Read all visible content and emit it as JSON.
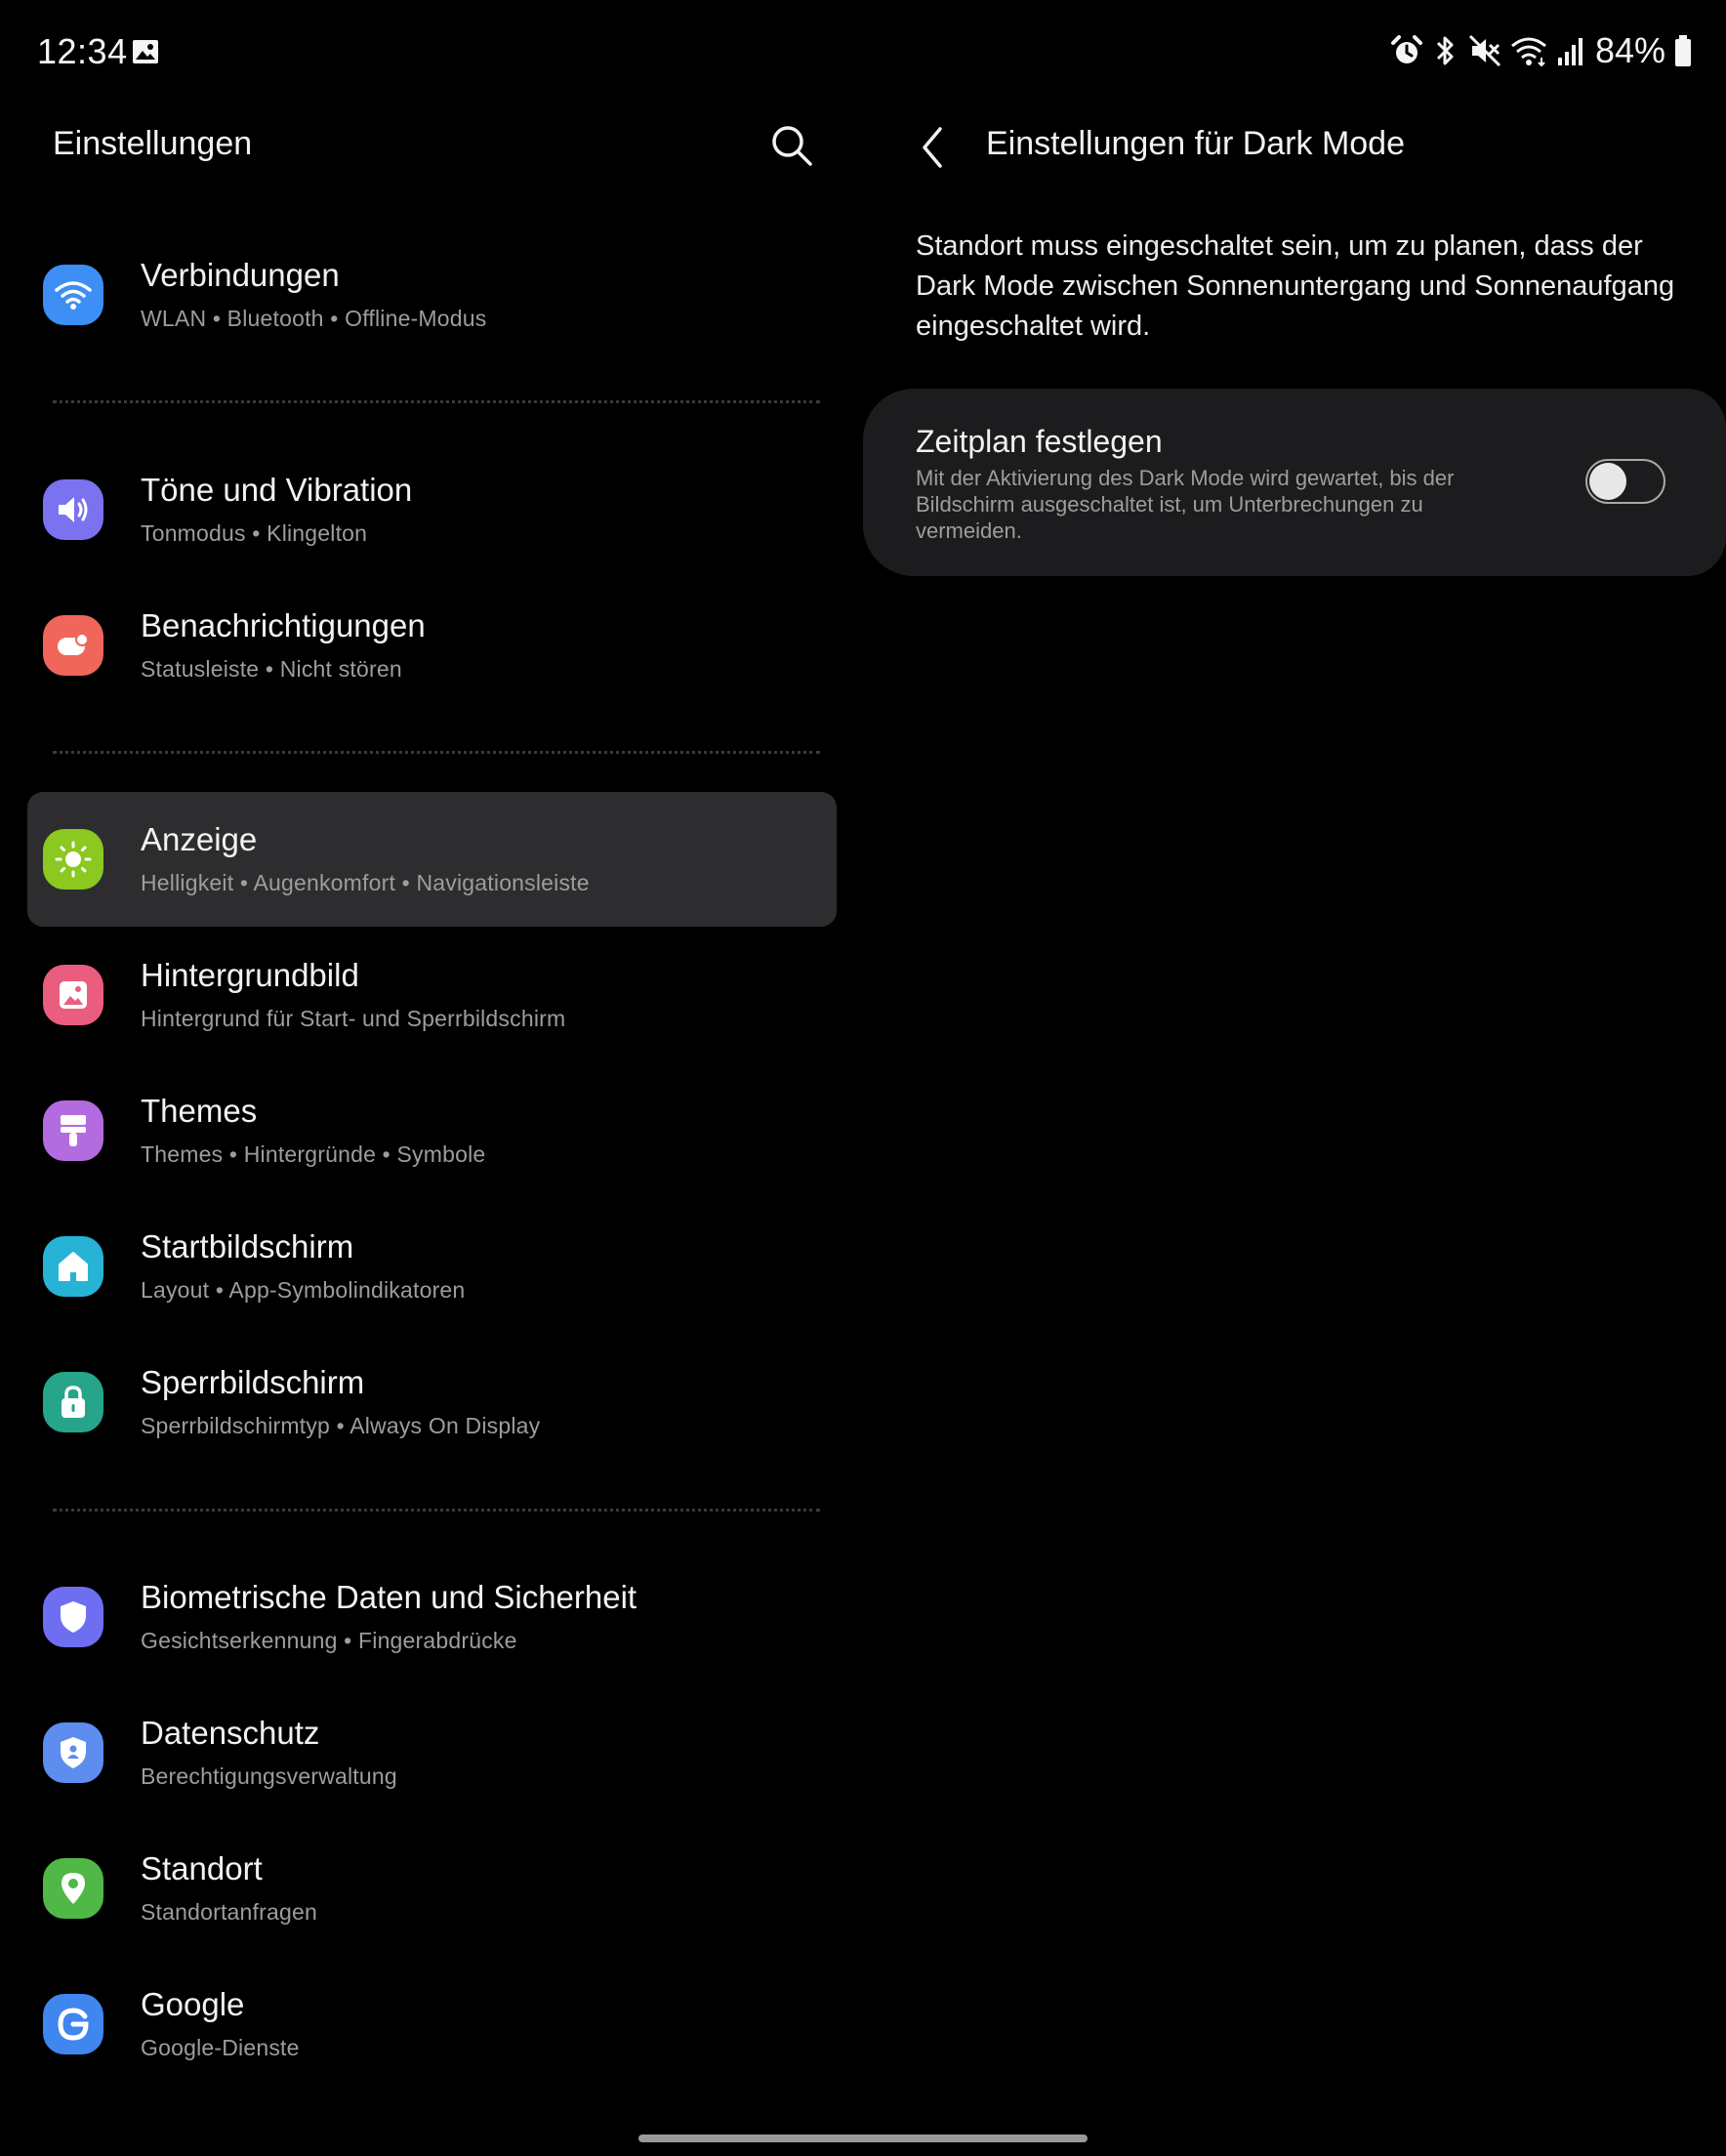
{
  "status_bar": {
    "time": "12:34",
    "battery_text": "84%",
    "icons": [
      "gallery-icon",
      "alarm-icon",
      "bluetooth-icon",
      "mute-icon",
      "wifi-icon",
      "signal-icon",
      "battery-icon"
    ]
  },
  "left_pane": {
    "title": "Einstellungen",
    "search_icon": "search-icon",
    "items": [
      {
        "title": "Verbindungen",
        "subtitle": "WLAN  •  Bluetooth  •  Offline-Modus",
        "icon": "wifi-icon",
        "color": "#3d8ff5"
      },
      {
        "title": "Töne und Vibration",
        "subtitle": "Tonmodus  •  Klingelton",
        "icon": "speaker-icon",
        "color": "#7b72f0"
      },
      {
        "title": "Benachrichtigungen",
        "subtitle": "Statusleiste  •  Nicht stören",
        "icon": "notification-icon",
        "color": "#f0665a"
      },
      {
        "title": "Anzeige",
        "subtitle": "Helligkeit  •  Augenkomfort  •  Navigationsleiste",
        "icon": "sun-icon",
        "color": "#8bc820",
        "selected": true
      },
      {
        "title": "Hintergrundbild",
        "subtitle": "Hintergrund für Start- und Sperrbildschirm",
        "icon": "wallpaper-icon",
        "color": "#ea5d7f"
      },
      {
        "title": "Themes",
        "subtitle": "Themes  •  Hintergründe  •  Symbole",
        "icon": "brush-icon",
        "color": "#b36be0"
      },
      {
        "title": "Startbildschirm",
        "subtitle": "Layout  •  App-Symbolindikatoren",
        "icon": "home-icon",
        "color": "#27b3d6"
      },
      {
        "title": "Sperrbildschirm",
        "subtitle": "Sperrbildschirmtyp  •  Always On Display",
        "icon": "lock-icon",
        "color": "#26a58a"
      },
      {
        "title": "Biometrische Daten und Sicherheit",
        "subtitle": "Gesichtserkennung  •  Fingerabdrücke",
        "icon": "shield-icon",
        "color": "#6e6ff0"
      },
      {
        "title": "Datenschutz",
        "subtitle": "Berechtigungsverwaltung",
        "icon": "privacy-shield-icon",
        "color": "#5c8def"
      },
      {
        "title": "Standort",
        "subtitle": "Standortanfragen",
        "icon": "location-pin-icon",
        "color": "#4fb847"
      },
      {
        "title": "Google",
        "subtitle": "Google-Dienste",
        "icon": "google-icon",
        "color": "#3f86ef"
      }
    ]
  },
  "right_pane": {
    "back_icon": "back-arrow-icon",
    "title": "Einstellungen für Dark Mode",
    "description": "Standort muss eingeschaltet sein, um zu planen, dass der Dark Mode zwischen Sonnenuntergang und Sonnenaufgang eingeschaltet wird.",
    "schedule": {
      "title": "Zeitplan festlegen",
      "description": "Mit der Aktivierung des Dark Mode wird gewartet, bis der Bildschirm ausgeschaltet ist, um Unterbrechungen zu vermeiden.",
      "enabled": false
    }
  }
}
